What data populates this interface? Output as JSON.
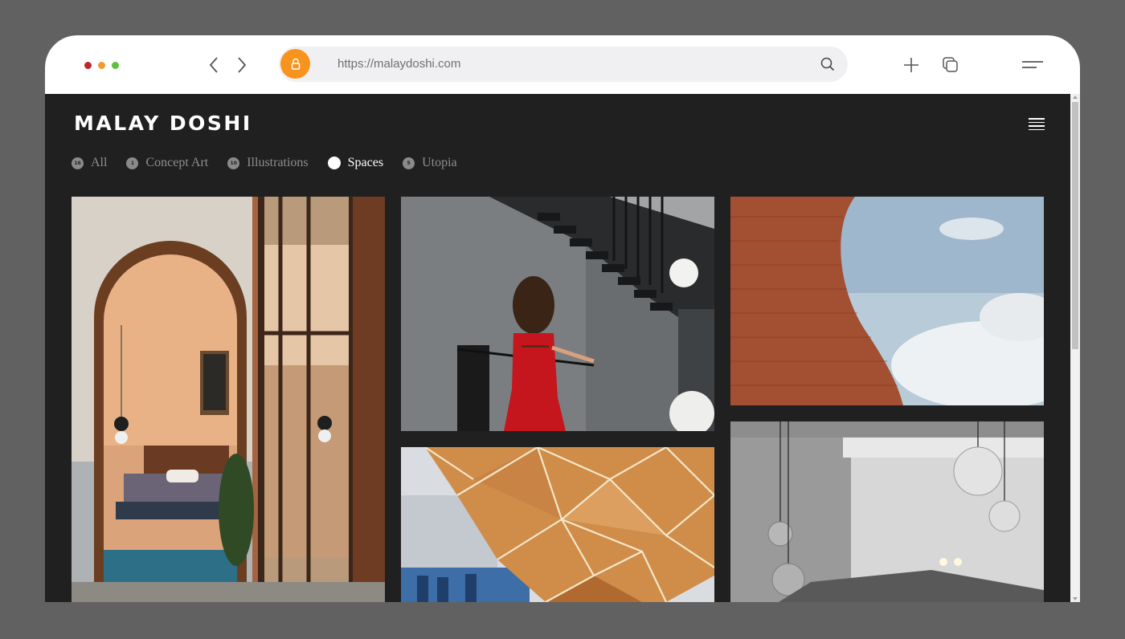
{
  "browser": {
    "url": "https://malaydoshi.com",
    "icons": [
      "window-close-dot",
      "window-minimize-dot",
      "window-maximize-dot",
      "back-arrow-icon",
      "forward-arrow-icon",
      "lock-icon",
      "search-icon",
      "new-tab-plus-icon",
      "tabs-overview-icon",
      "browser-menu-icon"
    ]
  },
  "site": {
    "brand": "MALAY DOSHI",
    "menu_icon": "hamburger-icon",
    "filters": [
      {
        "count": "16",
        "label": "All",
        "active": false
      },
      {
        "count": "1",
        "label": "Concept Art",
        "active": false
      },
      {
        "count": "10",
        "label": "Illustrations",
        "active": false
      },
      {
        "count": "",
        "label": "Spaces",
        "active": true
      },
      {
        "count": "5",
        "label": "Utopia",
        "active": false
      }
    ]
  },
  "gallery": {
    "photos": [
      {
        "subject": "arched-doorway-bedroom"
      },
      {
        "subject": "woman-in-red-on-staircase"
      },
      {
        "subject": "curved-brick-wall-sky"
      },
      {
        "subject": "faceted-wooden-sculpture"
      },
      {
        "subject": "pendant-glass-lamps-grey-wall"
      }
    ]
  },
  "colors": {
    "page_background": "#202020",
    "accent_orange": "#f7941d",
    "outer_background": "#616161"
  }
}
